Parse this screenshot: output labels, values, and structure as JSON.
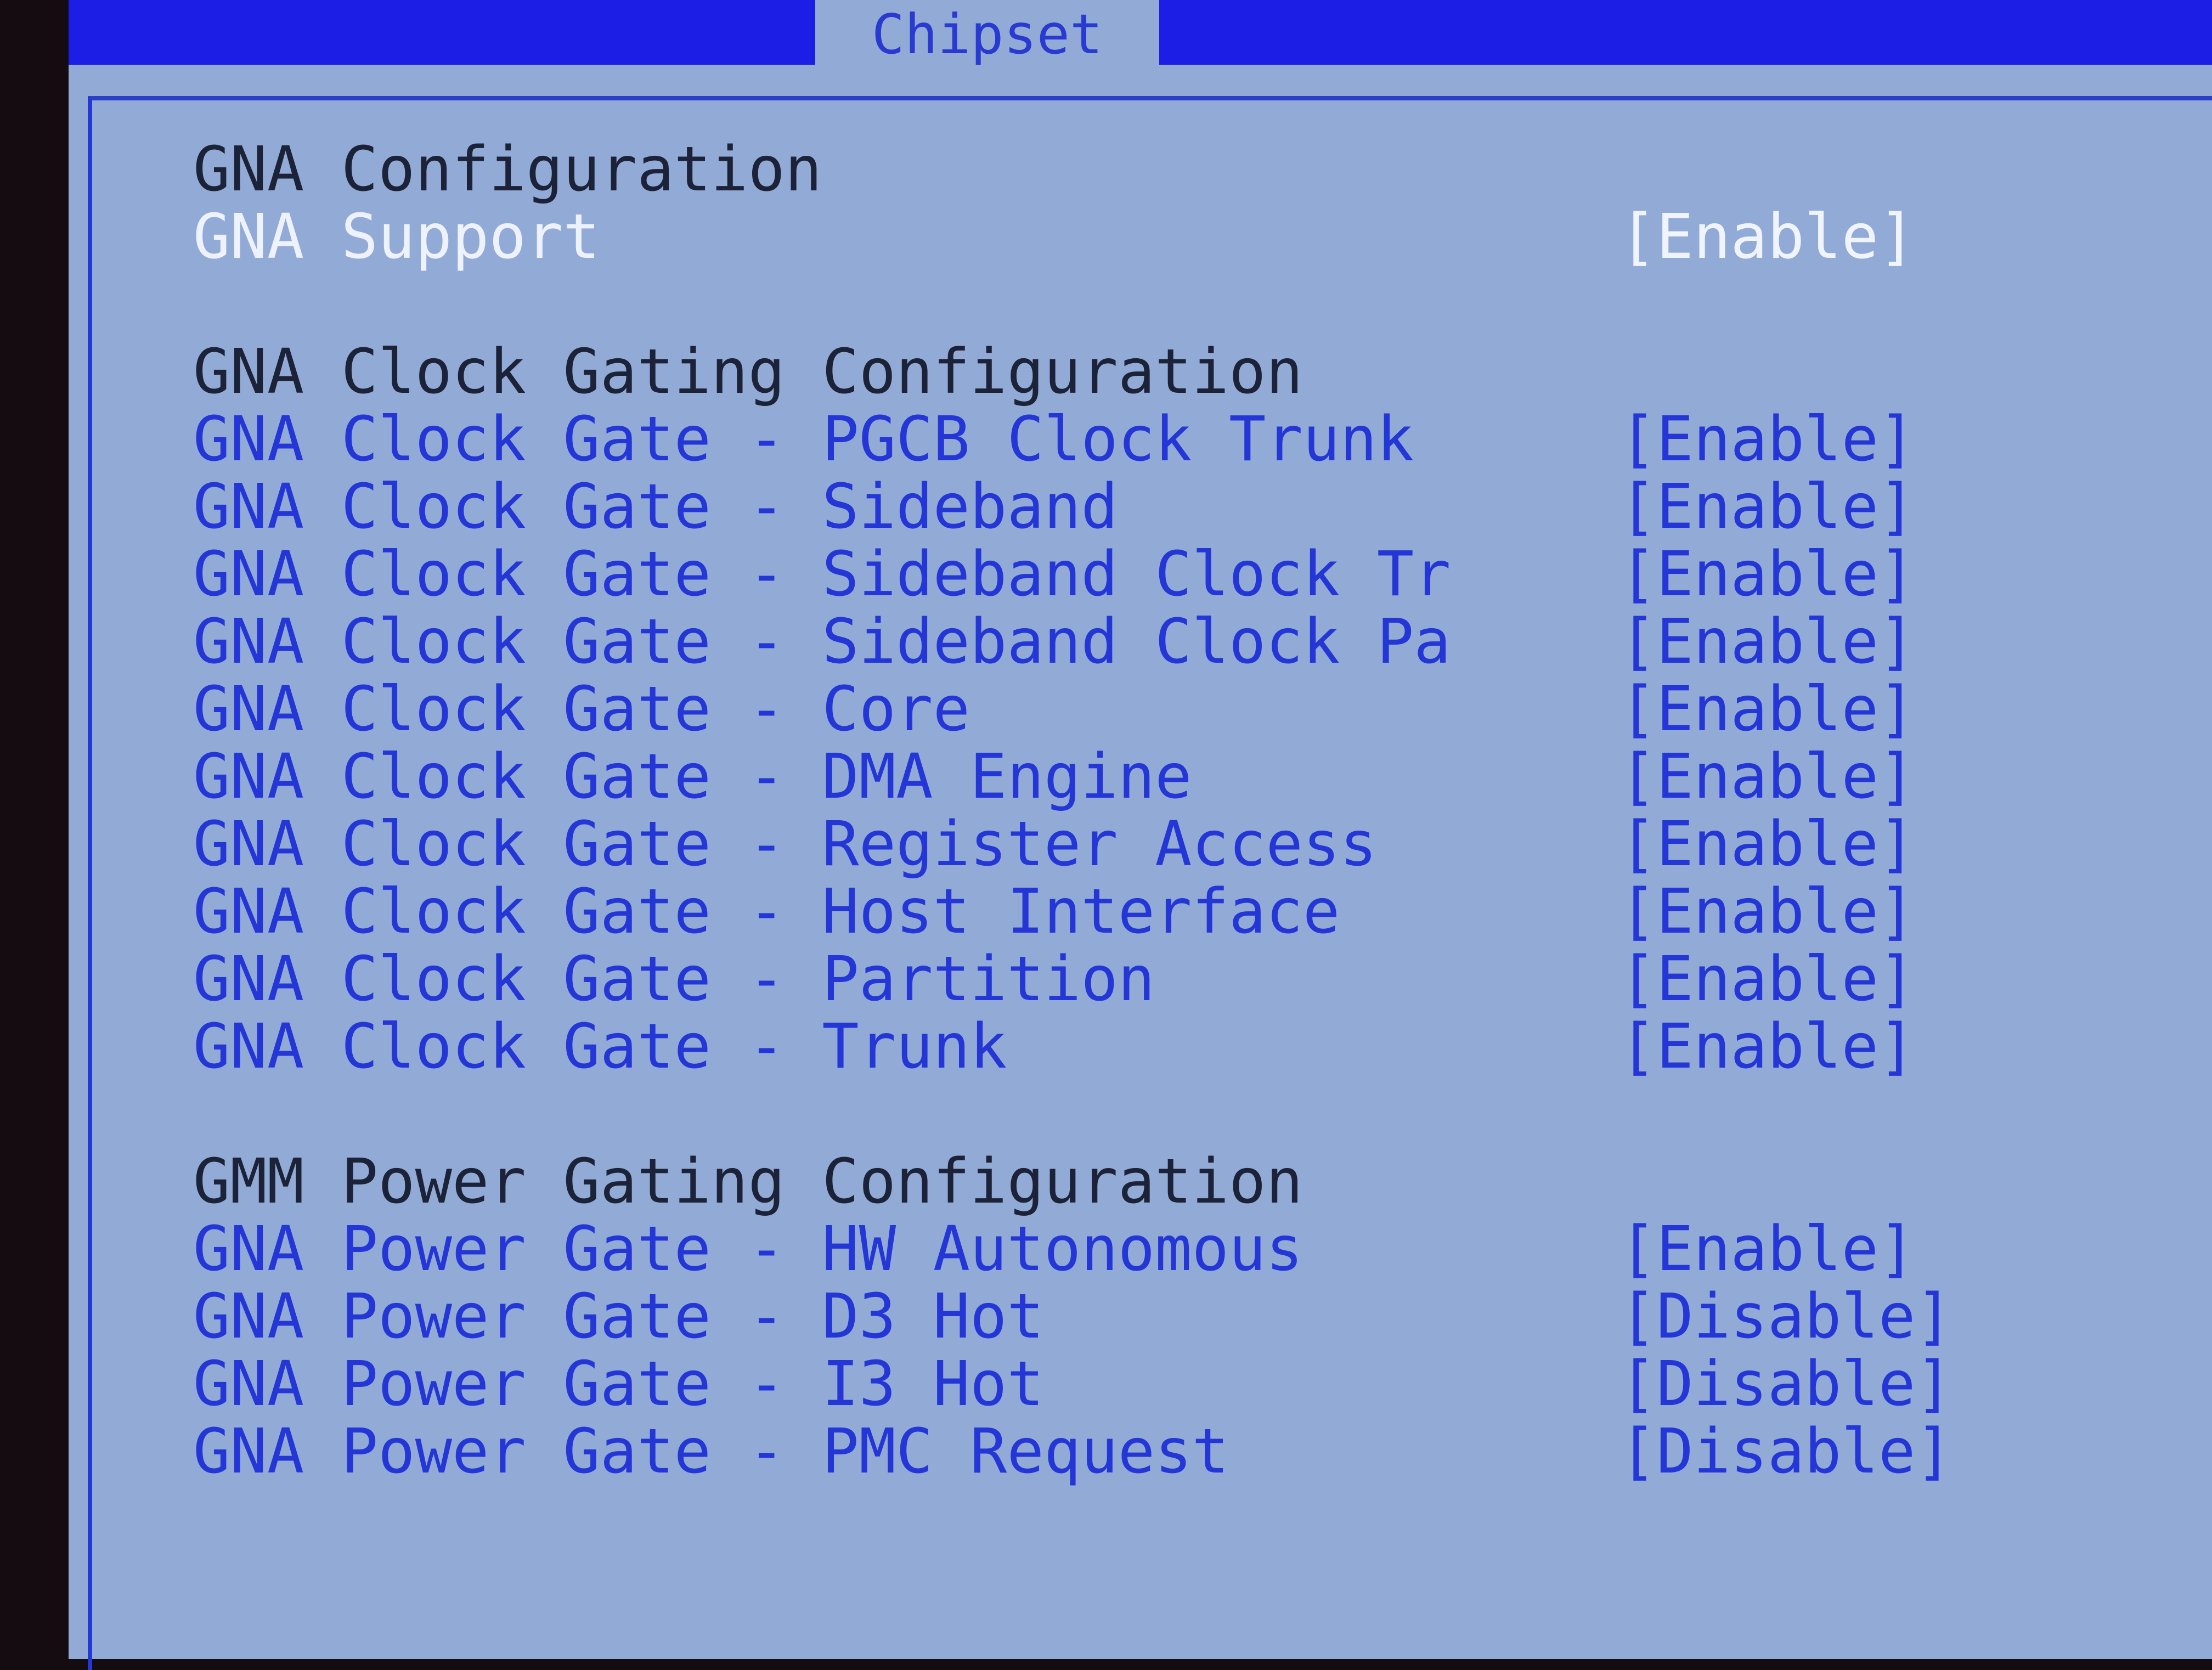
{
  "tabs": {
    "active": "Chipset"
  },
  "rows": [
    {
      "type": "header",
      "label": "GNA Configuration"
    },
    {
      "type": "selected",
      "label": "GNA Support",
      "value": "[Enable]"
    },
    {
      "type": "blank"
    },
    {
      "type": "header",
      "label": "GNA Clock Gating Configuration"
    },
    {
      "type": "item",
      "label": "GNA Clock Gate - PGCB Clock Trunk",
      "value": "[Enable]"
    },
    {
      "type": "item",
      "label": "GNA Clock Gate - Sideband",
      "value": "[Enable]"
    },
    {
      "type": "item",
      "label": "GNA Clock Gate - Sideband Clock Tr",
      "value": "[Enable]"
    },
    {
      "type": "item",
      "label": "GNA Clock Gate - Sideband Clock Pa",
      "value": "[Enable]"
    },
    {
      "type": "item",
      "label": "GNA Clock Gate - Core",
      "value": "[Enable]"
    },
    {
      "type": "item",
      "label": "GNA Clock Gate - DMA Engine",
      "value": "[Enable]"
    },
    {
      "type": "item",
      "label": "GNA Clock Gate - Register Access",
      "value": "[Enable]"
    },
    {
      "type": "item",
      "label": "GNA Clock Gate - Host Interface",
      "value": "[Enable]"
    },
    {
      "type": "item",
      "label": "GNA Clock Gate - Partition",
      "value": "[Enable]"
    },
    {
      "type": "item",
      "label": "GNA Clock Gate - Trunk",
      "value": "[Enable]"
    },
    {
      "type": "blank"
    },
    {
      "type": "header",
      "label": "GMM Power Gating Configuration"
    },
    {
      "type": "item",
      "label": "GNA Power Gate - HW Autonomous",
      "value": "[Enable]"
    },
    {
      "type": "item",
      "label": "GNA Power Gate - D3 Hot",
      "value": "[Disable]"
    },
    {
      "type": "item",
      "label": "GNA Power Gate - I3 Hot",
      "value": "[Disable]"
    },
    {
      "type": "item",
      "label": "GNA Power Gate - PMC Request",
      "value": "[Disable]"
    }
  ],
  "colors": {
    "header_bar": "#1c1ee6",
    "panel": "#92abd6",
    "item_text": "#2536d6",
    "selected_text": "#eef2ff",
    "heading_text": "#1c2238"
  }
}
